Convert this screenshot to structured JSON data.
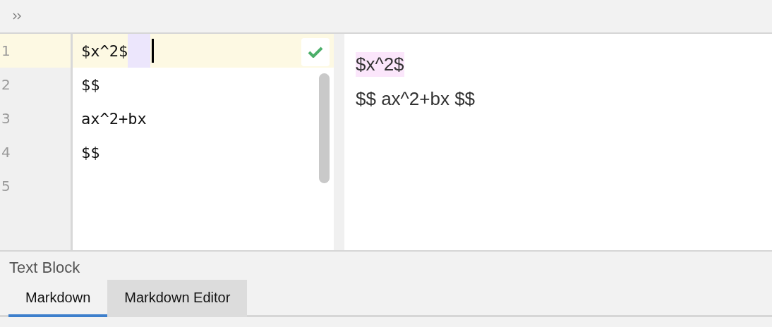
{
  "editor": {
    "lines": [
      {
        "number": "1",
        "text": "$x^2$",
        "current": true
      },
      {
        "number": "2",
        "text": "$$",
        "current": false
      },
      {
        "number": "3",
        "text": "ax^2+bx",
        "current": false
      },
      {
        "number": "4",
        "text": "$$",
        "current": false
      },
      {
        "number": "5",
        "current": false
      }
    ]
  },
  "preview": {
    "paragraphs": [
      {
        "text": "$x^2$",
        "highlighted": true
      },
      {
        "text": "$$ ax^2+bx $$",
        "highlighted": false
      }
    ]
  },
  "panel": {
    "title": "Text Block"
  },
  "tabs": [
    {
      "label": "Markdown",
      "selected": true
    },
    {
      "label": "Markdown Editor",
      "selected": false
    }
  ]
}
